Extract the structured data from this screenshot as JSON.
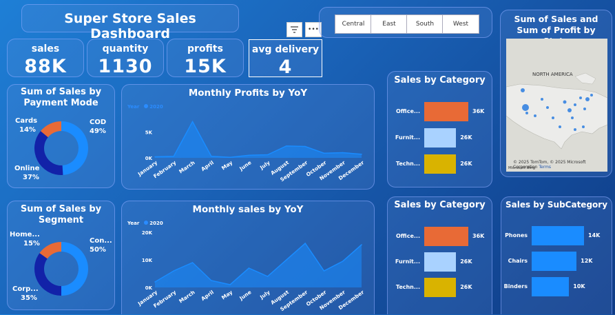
{
  "header": {
    "title": "Super Store Sales Dashboard"
  },
  "toolbar": {
    "filter_icon": "filter-icon",
    "more_icon": "more-icon",
    "more_label": "•••"
  },
  "kpis": [
    {
      "label": "sales",
      "value": "88K"
    },
    {
      "label": "quantity",
      "value": "1130"
    },
    {
      "label": "profits",
      "value": "15K"
    },
    {
      "label": "avg delivery",
      "value": "4"
    }
  ],
  "region_slicer": [
    "Central",
    "East",
    "South",
    "West"
  ],
  "map": {
    "title": "Sum of Sales and Sum of Profit by State",
    "region_label": "NORTH AMERICA",
    "attribution": "© 2025 TomTom, © 2025 Microsoft Corporation",
    "terms": "Terms",
    "bing": "Microsoft Bing"
  },
  "payment": {
    "title": "Sum of Sales by Payment Mode",
    "slices": [
      {
        "label": "COD",
        "pct": "49%",
        "value": 49,
        "color": "#1a8cff"
      },
      {
        "label": "Online",
        "pct": "37%",
        "value": 37,
        "color": "#1222a8"
      },
      {
        "label": "Cards",
        "pct": "14%",
        "value": 14,
        "color": "#e86a36"
      }
    ]
  },
  "segment": {
    "title": "Sum of Sales by Segment",
    "slices": [
      {
        "label": "Con...",
        "pct": "50%",
        "value": 50,
        "color": "#1a8cff"
      },
      {
        "label": "Corp...",
        "pct": "35%",
        "value": 35,
        "color": "#1222a8"
      },
      {
        "label": "Home...",
        "pct": "15%",
        "value": 15,
        "color": "#e86a36"
      }
    ]
  },
  "profits_chart": {
    "title": "Monthly Profits by YoY",
    "legend_title": "Year",
    "legend_value": "2020"
  },
  "sales_chart": {
    "title": "Monthly sales by YoY",
    "legend_title": "Year",
    "legend_value": "2020"
  },
  "category1": {
    "title": "Sales by Category"
  },
  "category2": {
    "title": "Sales by Category"
  },
  "subcategory": {
    "title": "Sales by SubCategory"
  },
  "chart_data": [
    {
      "type": "area",
      "title": "Monthly Profits by YoY",
      "x": [
        "January",
        "February",
        "March",
        "April",
        "May",
        "June",
        "July",
        "August",
        "September",
        "October",
        "November",
        "December"
      ],
      "series": [
        {
          "name": "2020",
          "values": [
            200,
            300,
            7000,
            300,
            100,
            500,
            600,
            2300,
            2200,
            900,
            1000,
            700
          ]
        }
      ],
      "ylim": [
        0,
        8000
      ],
      "yticks": [
        "0K",
        "5K"
      ],
      "color": "#1a8cff"
    },
    {
      "type": "area",
      "title": "Monthly sales by YoY",
      "x": [
        "January",
        "February",
        "March",
        "April",
        "May",
        "June",
        "July",
        "August",
        "September",
        "October",
        "November",
        "December"
      ],
      "series": [
        {
          "name": "2020",
          "values": [
            2000,
            6000,
            9000,
            2500,
            1000,
            7000,
            4000,
            10000,
            16000,
            6000,
            9500,
            15500
          ]
        }
      ],
      "ylim": [
        0,
        20000
      ],
      "yticks": [
        "0K",
        "10K",
        "20K"
      ],
      "color": "#1a8cff"
    },
    {
      "type": "bar",
      "title": "Sales by Category",
      "categories": [
        "Office...",
        "Furnit...",
        "Techn..."
      ],
      "values": [
        36,
        26,
        26
      ],
      "value_labels": [
        "36K",
        "26K",
        "26K"
      ],
      "colors": [
        "#e86a36",
        "#a9d2ff",
        "#d9b300"
      ]
    },
    {
      "type": "bar",
      "title": "Sales by Category",
      "categories": [
        "Office...",
        "Furnit...",
        "Techn..."
      ],
      "values": [
        36,
        26,
        26
      ],
      "value_labels": [
        "36K",
        "26K",
        "26K"
      ],
      "colors": [
        "#e86a36",
        "#a9d2ff",
        "#d9b300"
      ]
    },
    {
      "type": "bar",
      "title": "Sales by SubCategory",
      "categories": [
        "Phones",
        "Chairs",
        "Binders"
      ],
      "values": [
        14,
        12,
        10
      ],
      "value_labels": [
        "14K",
        "12K",
        "10K"
      ],
      "colors": [
        "#1a8cff",
        "#1a8cff",
        "#1a8cff"
      ]
    }
  ]
}
